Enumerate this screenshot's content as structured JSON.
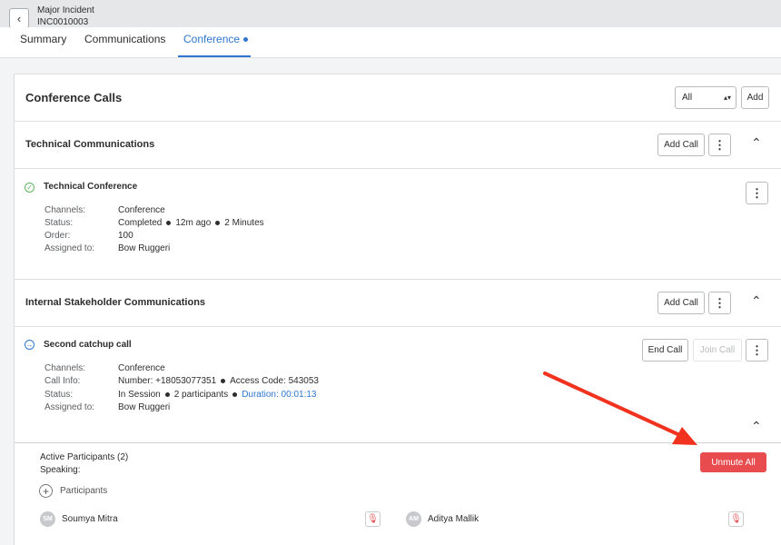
{
  "header": {
    "title": "Major Incident",
    "number": "INC0010003",
    "back_glyph": "‹"
  },
  "tabs": [
    {
      "label": "Summary"
    },
    {
      "label": "Communications"
    },
    {
      "label": "Conference",
      "active": true
    }
  ],
  "conference": {
    "title": "Conference Calls",
    "filter_value": "All",
    "add_label": "Add"
  },
  "sections": [
    {
      "title": "Technical Communications",
      "add_call_label": "Add Call",
      "item": {
        "title": "Technical Conference",
        "status_icon": "check-circle-icon",
        "labels": {
          "channels": "Channels:",
          "status": "Status:",
          "order": "Order:",
          "assigned": "Assigned to:"
        },
        "channels": "Conference",
        "status_main": "Completed",
        "status_time": "12m ago",
        "status_duration": "2 Minutes",
        "order": "100",
        "assigned": "Bow Ruggeri"
      }
    },
    {
      "title": "Internal Stakeholder Communications",
      "add_call_label": "Add Call",
      "item": {
        "title": "Second catchup call",
        "status_icon": "arrow-circle-icon",
        "labels": {
          "channels": "Channels:",
          "callinfo": "Call Info:",
          "status": "Status:",
          "assigned": "Assigned to:"
        },
        "channels": "Conference",
        "call_number": "Number: +18053077351",
        "access_code": "Access Code: 543053",
        "status_main": "In Session",
        "participants_count": "2 participants",
        "duration": "Duration:  00:01:13",
        "assigned": "Bow Ruggeri",
        "end_call_label": "End Call",
        "join_call_label": "Join Call"
      }
    }
  ],
  "participants": {
    "active_label": "Active Participants (2)",
    "speaking_label": "Speaking:",
    "participants_label": "Participants",
    "unmute_all_label": "Unmute All",
    "list": [
      {
        "initials": "SM",
        "name": "Soumya Mitra"
      },
      {
        "initials": "AM",
        "name": "Aditya Mallik"
      }
    ]
  },
  "colors": {
    "accent": "#2e77d0",
    "danger": "#e84c4f",
    "annotation_arrow": "#f0321e"
  }
}
